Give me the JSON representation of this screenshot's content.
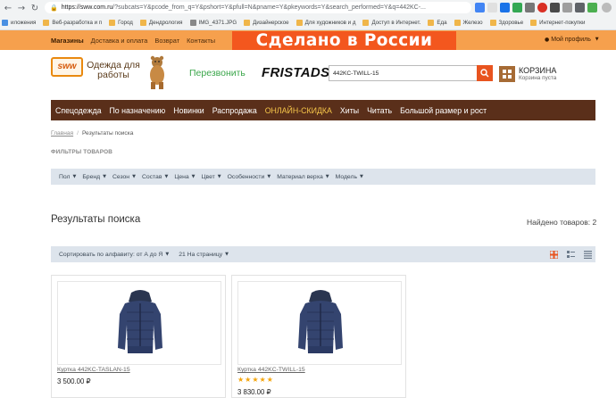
{
  "browser": {
    "url_host": "https://sww.com.ru",
    "url_rest": "/?subcats=Y&pcode_from_q=Y&pshort=Y&pfull=N&pname=Y&pkeywords=Y&search_performed=Y&q=442KC-...",
    "bookmarks": [
      {
        "label": "иложения",
        "color": "#4a90e2"
      },
      {
        "label": "Веб-разработка и п",
        "color": "#f0b64a"
      },
      {
        "label": "Город",
        "color": "#f0b64a"
      },
      {
        "label": "Дендрология",
        "color": "#f0b64a"
      },
      {
        "label": "IMG_4371.JPG",
        "color": "#888888"
      },
      {
        "label": "Дизайнерское",
        "color": "#f0b64a"
      },
      {
        "label": "Для художников и д",
        "color": "#f0b64a"
      },
      {
        "label": "Доступ в Интернет.",
        "color": "#f0b64a"
      },
      {
        "label": "Еда",
        "color": "#f0b64a"
      },
      {
        "label": "Железо",
        "color": "#f0b64a"
      },
      {
        "label": "Здоровье",
        "color": "#f0b64a"
      },
      {
        "label": "Интернет-покупки",
        "color": "#f0b64a"
      }
    ]
  },
  "topbar": {
    "links": [
      "Магазины",
      "Доставка и оплата",
      "Возврат",
      "Контакты"
    ],
    "banner": "Сделано в России",
    "profile": "Мой профиль"
  },
  "header": {
    "logo_badge": "sww",
    "logo_text": "Одежда для работы",
    "callback": "Перезвонить",
    "brand": "FRISTADS",
    "search_value": "442KC-TWILL-15",
    "cart_title": "КОРЗИНА",
    "cart_sub": "Корзина пуста"
  },
  "mainnav": [
    "Спецодежда",
    "По назначению",
    "Новинки",
    "Распродажа",
    "ОНЛАЙН-СКИДКА",
    "Хиты",
    "Читать",
    "Большой размер и рост"
  ],
  "breadcrumbs": {
    "home": "Главная",
    "sep": "/",
    "current": "Результаты поиска"
  },
  "filters_title": "ФИЛЬТРЫ ТОВАРОВ",
  "filters": [
    "Пол",
    "Бренд",
    "Сезон",
    "Состав",
    "Цена",
    "Цвет",
    "Особенности",
    "Материал верха",
    "Модель"
  ],
  "results": {
    "title": "Результаты поиска",
    "found": "Найдено товаров: 2"
  },
  "sorting": {
    "sort": "Сортировать по алфавиту: от А до Я",
    "per_page": "21 На страницу"
  },
  "products": [
    {
      "name": "Куртка 442KC-TASLAN-15",
      "price": "3 500.00 ₽",
      "rating": 0
    },
    {
      "name": "Куртка 442KC-TWILL-15",
      "price": "3 830.00 ₽",
      "rating": 5
    }
  ],
  "colors": {
    "orange": "#f6a04d",
    "banner": "#f3571e",
    "nav": "#5a2f1a",
    "accent": "#e8541f",
    "filter_bg": "#dde4ec"
  }
}
